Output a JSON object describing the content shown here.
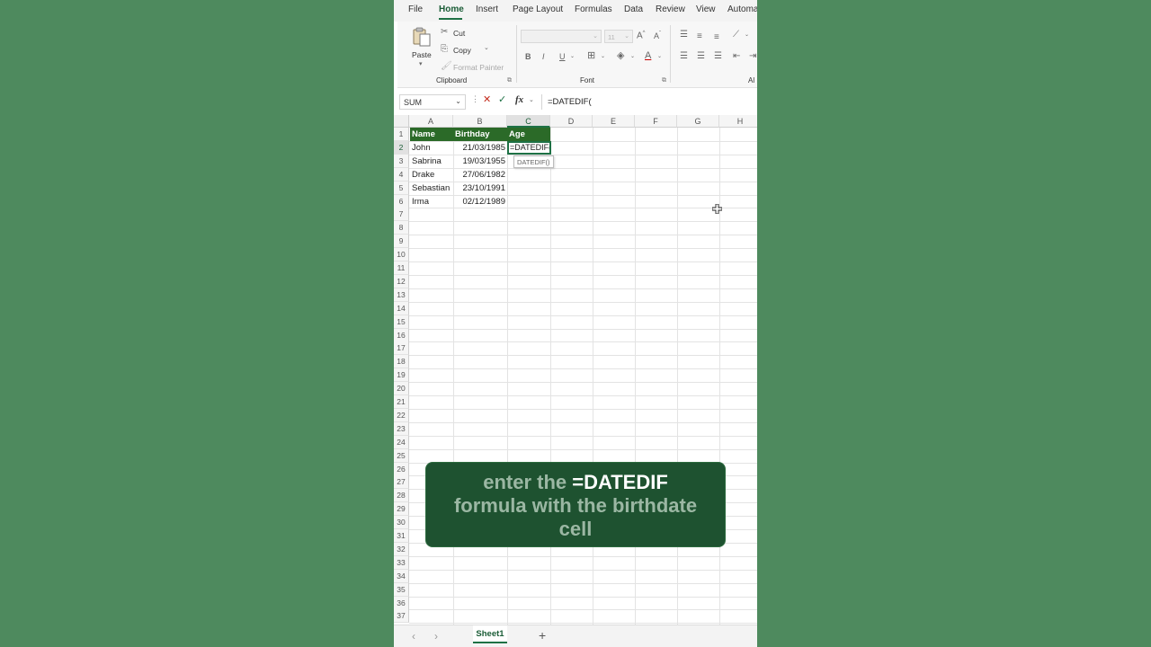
{
  "menu": {
    "items": [
      "File",
      "Home",
      "Insert",
      "Page Layout",
      "Formulas",
      "Data",
      "Review",
      "View",
      "Automa"
    ]
  },
  "ribbon": {
    "clipboard": {
      "paste": "Paste",
      "cut": "Cut",
      "copy": "Copy",
      "format_painter": "Format Painter",
      "group_label": "Clipboard"
    },
    "font": {
      "font_name": "",
      "font_size": "11",
      "group_label": "Font",
      "bold": "B",
      "italic": "I",
      "underline": "U"
    },
    "alignment": {
      "group_label": "Al"
    }
  },
  "formula_bar": {
    "name_box": "SUM",
    "formula": "=DATEDIF("
  },
  "grid": {
    "columns": [
      "A",
      "B",
      "C",
      "D",
      "E",
      "F",
      "G",
      "H"
    ],
    "row_count": 37,
    "header_row": [
      "Name",
      "Birthday",
      "Age"
    ],
    "rows": [
      {
        "name": "John",
        "birthday": "21/03/1985",
        "age": "=DATEDIF("
      },
      {
        "name": "Sabrina",
        "birthday": "19/03/1955",
        "age": ""
      },
      {
        "name": "Drake",
        "birthday": "27/06/1982",
        "age": ""
      },
      {
        "name": "Sebastian",
        "birthday": "23/10/1991",
        "age": ""
      },
      {
        "name": "Irma",
        "birthday": "02/12/1989",
        "age": ""
      }
    ],
    "active_cell": "C2",
    "tooltip": "DATEDIF()"
  },
  "sheet_tabs": {
    "active": "Sheet1",
    "add": "+"
  },
  "caption": {
    "line1_pre": "enter the ",
    "line1_highlight": "=DATEDIF",
    "line2": "formula with the birthdate",
    "line3": "cell"
  },
  "colors": {
    "background": "#4e8a5e",
    "accent": "#1e7145",
    "header_fill": "#2b6a28",
    "caption_bg": "#1e5230"
  }
}
